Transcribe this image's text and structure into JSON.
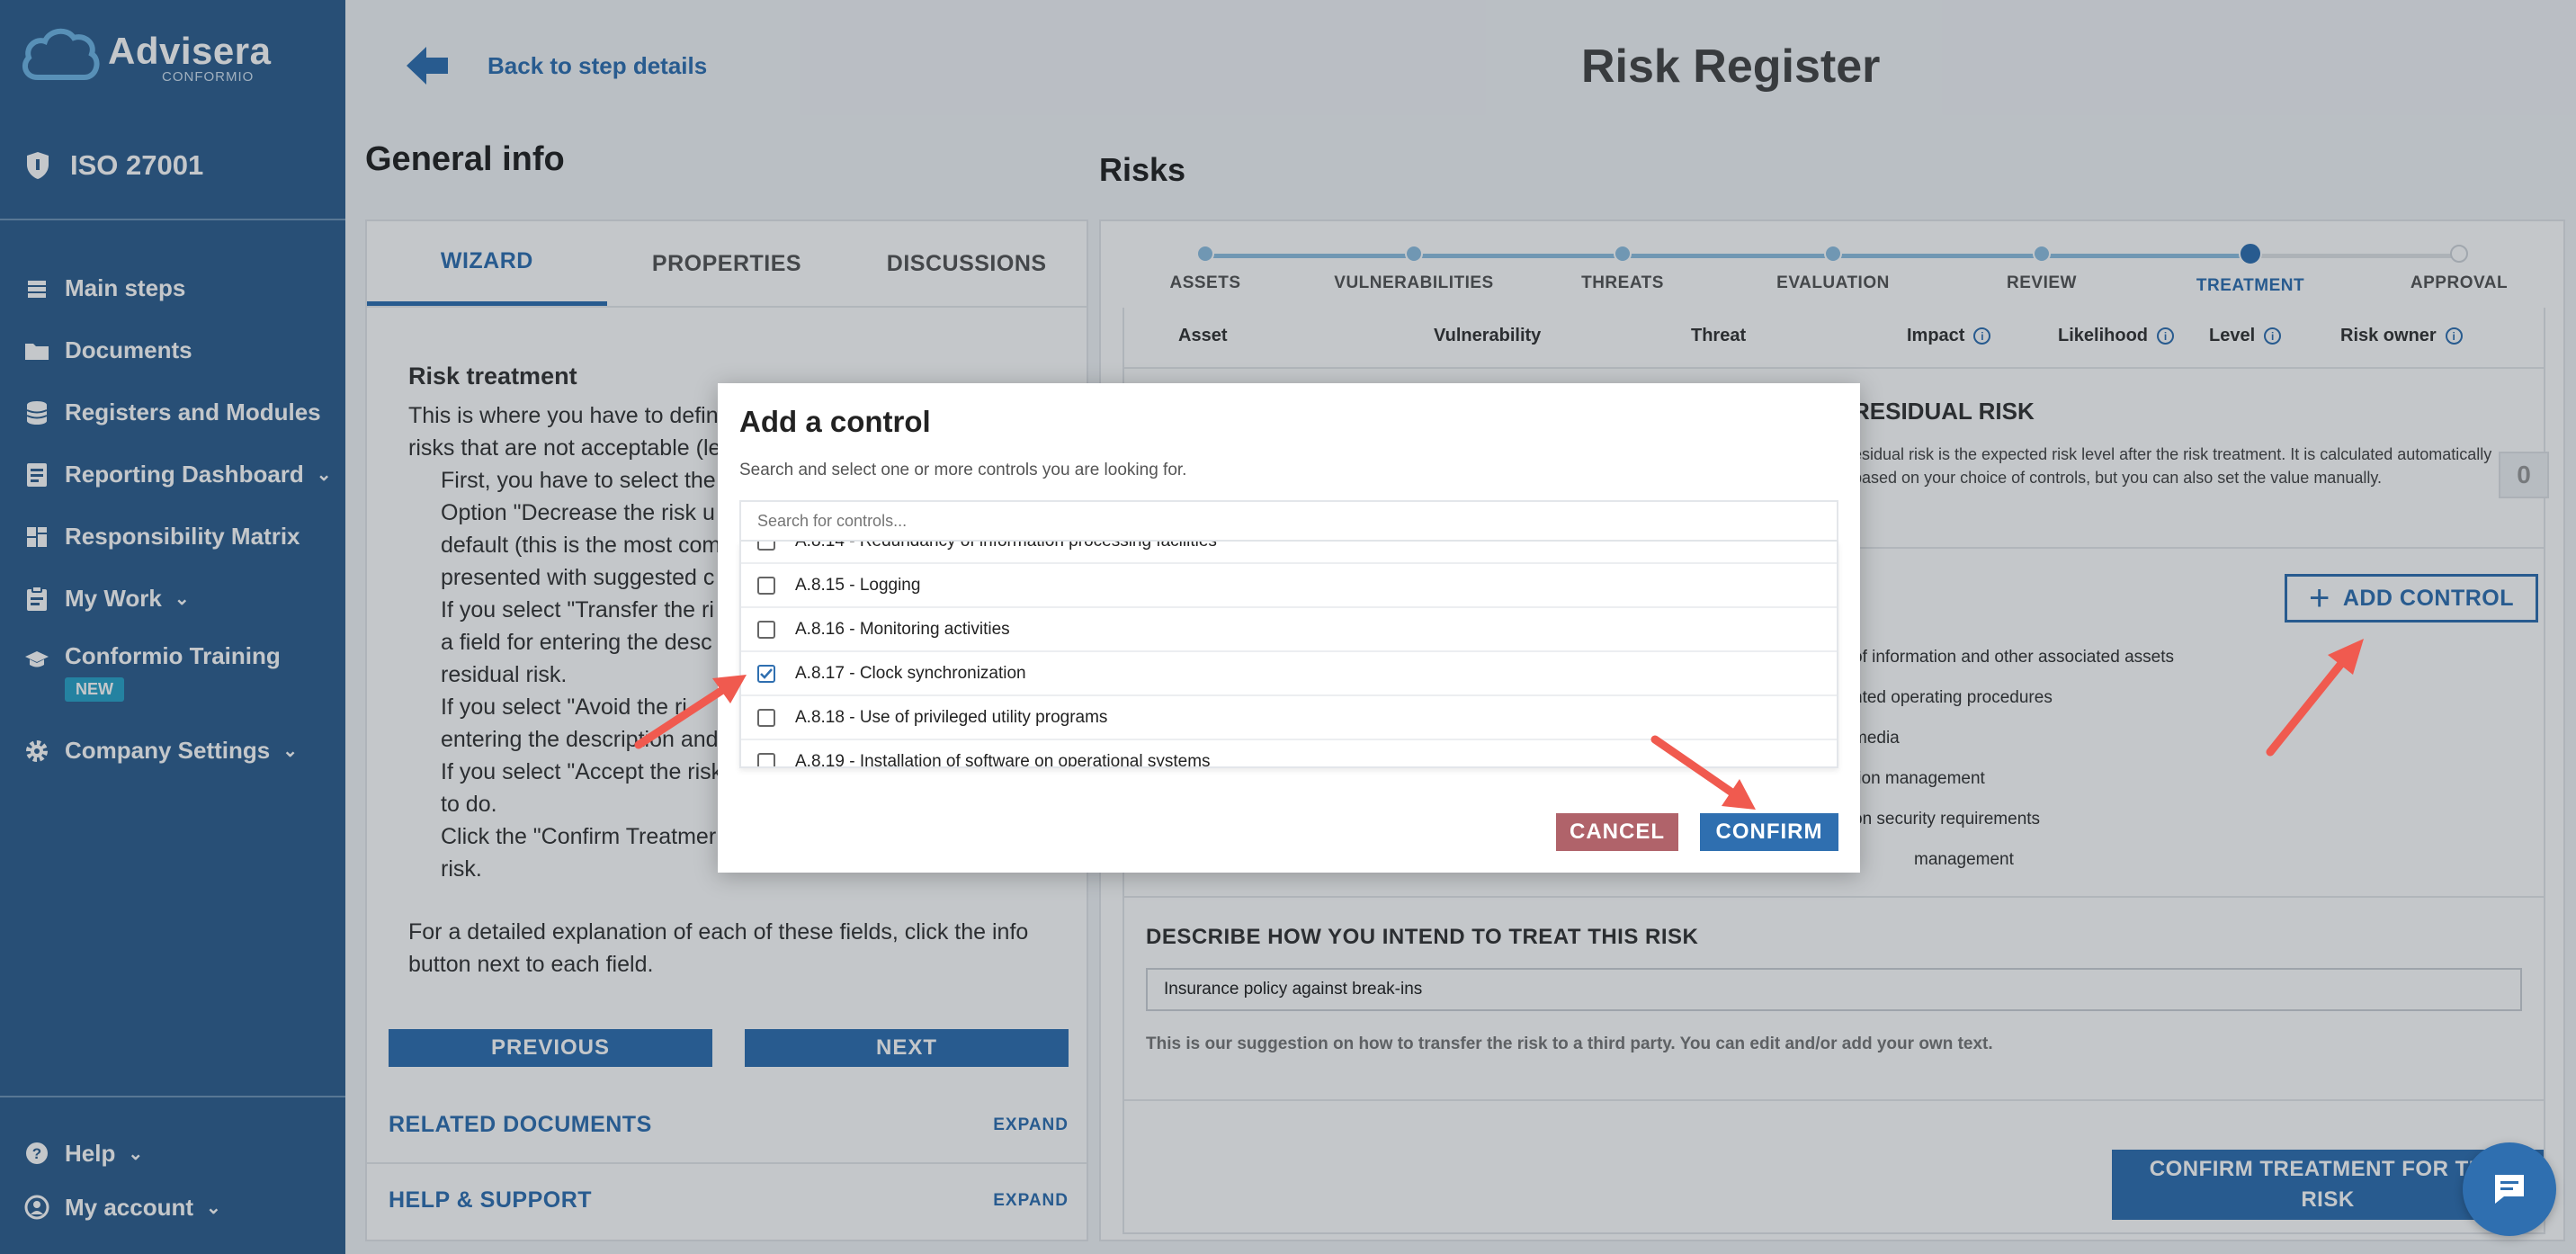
{
  "brand": {
    "name": "Advisera",
    "sub": "CONFORMIO"
  },
  "standard": "ISO 27001",
  "sidebar": {
    "items": [
      {
        "label": "Main steps",
        "icon": "layers-icon"
      },
      {
        "label": "Documents",
        "icon": "folder-icon"
      },
      {
        "label": "Registers and Modules",
        "icon": "database-icon"
      },
      {
        "label": "Reporting Dashboard",
        "icon": "report-icon"
      },
      {
        "label": "Responsibility Matrix",
        "icon": "grid-icon"
      },
      {
        "label": "My Work",
        "icon": "clipboard-icon"
      },
      {
        "label": "Conformio Training",
        "icon": "graduation-cap-icon",
        "badge": "NEW"
      },
      {
        "label": "Company Settings",
        "icon": "gear-icon"
      }
    ],
    "bottom": [
      {
        "label": "Help",
        "icon": "help-icon"
      },
      {
        "label": "My account",
        "icon": "user-icon"
      }
    ]
  },
  "header": {
    "back_label": "Back to step details",
    "title": "Risk Register"
  },
  "general": {
    "title": "General info",
    "tabs": [
      "WIZARD",
      "PROPERTIES",
      "DISCUSSIONS"
    ],
    "wizard_heading": "Risk treatment",
    "wizard_lines": [
      "This is where you have to defin",
      "risks that are not acceptable (le"
    ],
    "wizard_indented": [
      "First, you have to select the",
      "Option \"Decrease the risk u",
      "default (this is the most com",
      "presented with suggested c",
      "If you select \"Transfer the ri",
      "a field for entering the desc",
      "residual risk.",
      "If you select \"Avoid the ri",
      "entering the description and",
      "If you select \"Accept the risk",
      "to do.",
      "Click the \"Confirm Treatmer",
      "risk."
    ],
    "wizard_note": "For a detailed explanation of each of these fields, click the info button next to each field.",
    "previous": "PREVIOUS",
    "next": "NEXT",
    "related_docs": "RELATED DOCUMENTS",
    "help_support": "HELP & SUPPORT",
    "expand": "EXPAND"
  },
  "risks": {
    "title": "Risks",
    "steps": [
      "ASSETS",
      "VULNERABILITIES",
      "THREATS",
      "EVALUATION",
      "REVIEW",
      "TREATMENT",
      "APPROVAL"
    ],
    "current_step": "TREATMENT",
    "columns": [
      "Asset",
      "Vulnerability",
      "Threat",
      "Impact",
      "Likelihood",
      "Level",
      "Risk owner"
    ],
    "residual_title": "RESIDUAL RISK",
    "residual_text": "esidual risk is the expected risk level after the risk treatment. It is calculated automatically based on your choice of controls, but you can also set the value manually.",
    "residual_value": "0",
    "add_control": "ADD CONTROL",
    "controls_visible": [
      "of information and other associated assets",
      "nted operating procedures",
      "media",
      "tion management",
      "on security requirements",
      "management"
    ],
    "treat_title": "DESCRIBE HOW YOU INTEND TO TREAT THIS RISK",
    "treat_value": "Insurance policy against break-ins",
    "treat_hint": "This is our suggestion on how to transfer the risk to a third party. You can edit and/or add your own text.",
    "confirm_treatment_line1": "CONFIRM TREATMENT FOR THIS",
    "confirm_treatment_line2": "RISK"
  },
  "modal": {
    "title": "Add a control",
    "subtitle": "Search and select one or more controls you are looking for.",
    "search_placeholder": "Search for controls...",
    "items": [
      {
        "label": "A.8.14 - Redundancy of information processing facilities",
        "checked": false
      },
      {
        "label": "A.8.15 - Logging",
        "checked": false
      },
      {
        "label": "A.8.16 - Monitoring activities",
        "checked": false
      },
      {
        "label": "A.8.17 - Clock synchronization",
        "checked": true
      },
      {
        "label": "A.8.18 - Use of privileged utility programs",
        "checked": false
      },
      {
        "label": "A.8.19 - Installation of software on operational systems",
        "checked": false
      }
    ],
    "cancel": "CANCEL",
    "confirm": "CONFIRM"
  },
  "colors": {
    "sidebar": "#2f5f8f",
    "accent": "#2f6fb0",
    "cancel": "#b0636a",
    "arrow": "#f05a4f"
  }
}
